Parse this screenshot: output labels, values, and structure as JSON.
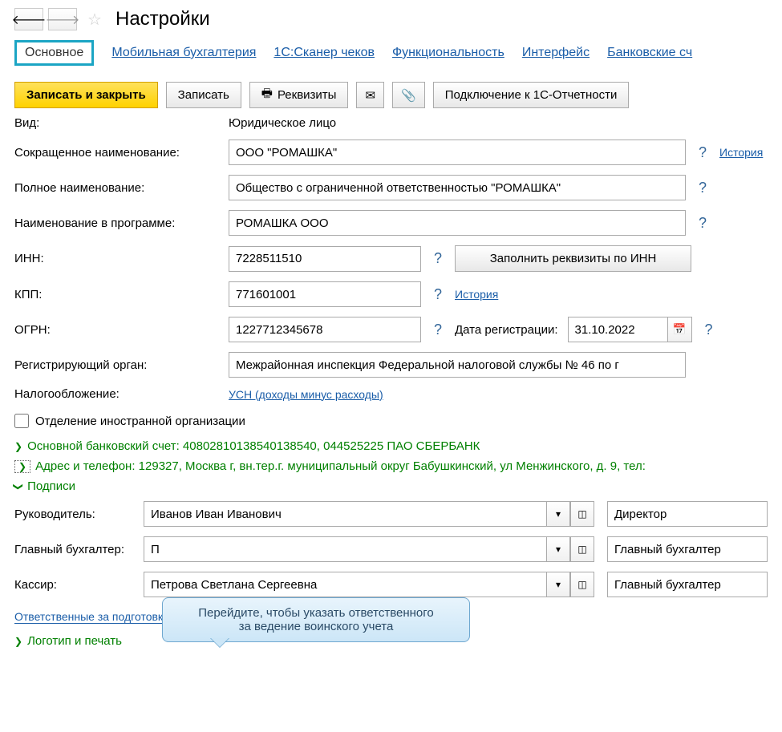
{
  "header": {
    "title": "Настройки"
  },
  "tabs": [
    "Основное",
    "Мобильная бухгалтерия",
    "1С:Сканер чеков",
    "Функциональность",
    "Интерфейс",
    "Банковские сч"
  ],
  "toolbar": {
    "save_close": "Записать и закрыть",
    "save": "Записать",
    "requisites": "Реквизиты",
    "connect_reporting": "Подключение к 1С-Отчетности"
  },
  "form": {
    "type_label": "Вид:",
    "type_value": "Юридическое лицо",
    "short_name_label": "Сокращенное наименование:",
    "short_name_value": "ООО \"РОМАШКА\"",
    "full_name_label": "Полное наименование:",
    "full_name_value": "Общество с ограниченной ответственностью \"РОМАШКА\"",
    "program_name_label": "Наименование в программе:",
    "program_name_value": "РОМАШКА ООО",
    "inn_label": "ИНН:",
    "inn_value": "7228511510",
    "fill_by_inn": "Заполнить реквизиты по ИНН",
    "kpp_label": "КПП:",
    "kpp_value": "771601001",
    "ogrn_label": "ОГРН:",
    "ogrn_value": "1227712345678",
    "reg_date_label": "Дата регистрации:",
    "reg_date_value": "31.10.2022",
    "reg_authority_label": "Регистрирующий орган:",
    "reg_authority_value": "Межрайонная инспекция Федеральной налоговой службы № 46 по г",
    "taxation_label": "Налогообложение:",
    "taxation_value": "УСН (доходы минус расходы)",
    "foreign_branch": "Отделение иностранной организации",
    "history": "История"
  },
  "sections": {
    "bank_account": "Основной банковский счет: 40802810138540138540, 044525225 ПАО СБЕРБАНК",
    "address": "Адрес и телефон: 129327, Москва г, вн.тер.г. муниципальный округ Бабушкинский, ул Менжинского, д. 9, тел:",
    "signatures": "Подписи",
    "logo_stamp": "Логотип и печать"
  },
  "signatures": {
    "director_label": "Руководитель:",
    "director_value": "Иванов Иван Иванович",
    "director_role": "Директор",
    "accountant_label": "Главный бухгалтер:",
    "accountant_value": "П",
    "accountant_role": "Главный бухгалтер",
    "cashier_label": "Кассир:",
    "cashier_value": "Петрова Светлана Сергеевна",
    "cashier_role": "Главный бухгалтер"
  },
  "links": {
    "report_responsibles": "Ответственные за подготовку отчетов"
  },
  "tooltip": {
    "line1": "Перейдите, чтобы указать ответственного",
    "line2": "за ведение воинского учета"
  }
}
